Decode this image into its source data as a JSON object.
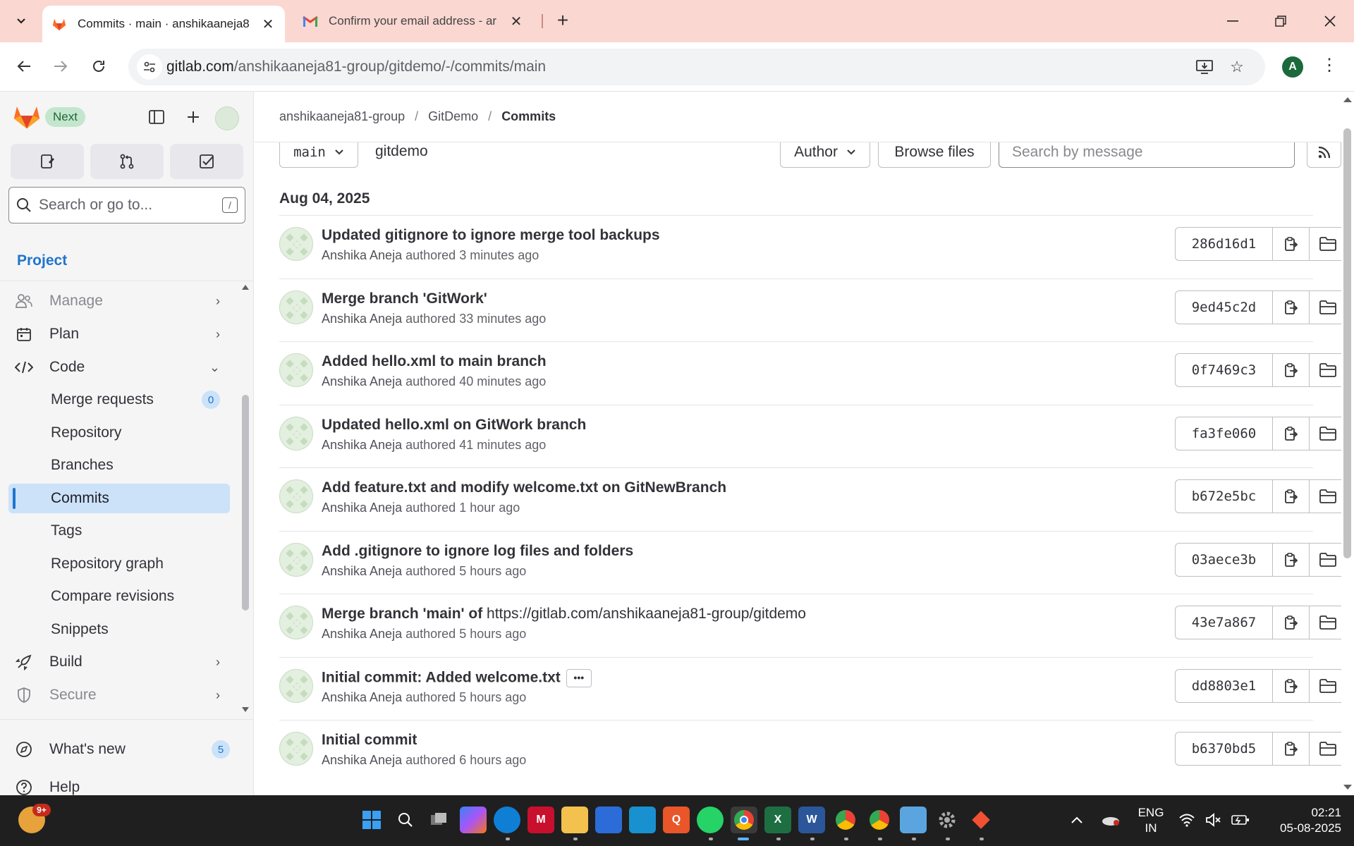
{
  "browser": {
    "tabs": [
      {
        "title": "Commits · main · anshikaaneja8",
        "active": true
      },
      {
        "title": "Confirm your email address - ar",
        "active": false
      }
    ],
    "url_host": "gitlab.com",
    "url_path": "/anshikaaneja81-group/gitdemo/-/commits/main",
    "profile_initial": "A"
  },
  "sidebar": {
    "next_label": "Next",
    "search_placeholder": "Search or go to...",
    "search_shortcut": "/",
    "section_title": "Project",
    "items": [
      {
        "label": "Manage",
        "icon": "users-icon",
        "chevron": "›"
      },
      {
        "label": "Plan",
        "icon": "calendar-icon",
        "chevron": "›"
      },
      {
        "label": "Code",
        "icon": "code-icon",
        "chevron": "⌄"
      },
      {
        "label": "Merge requests",
        "badge": "0"
      },
      {
        "label": "Repository"
      },
      {
        "label": "Branches"
      },
      {
        "label": "Commits"
      },
      {
        "label": "Tags"
      },
      {
        "label": "Repository graph"
      },
      {
        "label": "Compare revisions"
      },
      {
        "label": "Snippets"
      },
      {
        "label": "Build",
        "icon": "rocket-icon",
        "chevron": "›"
      },
      {
        "label": "Secure",
        "icon": "shield-icon",
        "chevron": "›"
      }
    ],
    "whats_new": {
      "label": "What's new",
      "badge": "5"
    },
    "help": {
      "label": "Help"
    }
  },
  "breadcrumb": [
    "anshikaaneja81-group",
    "GitDemo",
    "Commits"
  ],
  "filters": {
    "branch": "main",
    "path": "gitdemo",
    "author_label": "Author",
    "browse_label": "Browse files",
    "search_placeholder": "Search by message"
  },
  "date_heading": "Aug 04, 2025",
  "commits": [
    {
      "title": "Updated gitignore to ignore merge tool backups",
      "author": "Anshika Aneja",
      "verb": "authored",
      "time": "3 minutes ago",
      "sha": "286d16d1"
    },
    {
      "title": "Merge branch 'GitWork'",
      "author": "Anshika Aneja",
      "verb": "authored",
      "time": "33 minutes ago",
      "sha": "9ed45c2d"
    },
    {
      "title": "Added hello.xml to main branch",
      "author": "Anshika Aneja",
      "verb": "authored",
      "time": "40 minutes ago",
      "sha": "0f7469c3"
    },
    {
      "title": "Updated hello.xml on GitWork branch",
      "author": "Anshika Aneja",
      "verb": "authored",
      "time": "41 minutes ago",
      "sha": "fa3fe060"
    },
    {
      "title": "Add feature.txt and modify welcome.txt on GitNewBranch",
      "author": "Anshika Aneja",
      "verb": "authored",
      "time": "1 hour ago",
      "sha": "b672e5bc"
    },
    {
      "title": "Add .gitignore to ignore log files and folders",
      "author": "Anshika Aneja",
      "verb": "authored",
      "time": "5 hours ago",
      "sha": "03aece3b"
    },
    {
      "title": "Merge branch 'main' of ",
      "link": "https://gitlab.com/anshikaaneja81-group/gitdemo",
      "author": "Anshika Aneja",
      "verb": "authored",
      "time": "5 hours ago",
      "sha": "43e7a867"
    },
    {
      "title": "Initial commit: Added welcome.txt",
      "ellipsis": "•••",
      "author": "Anshika Aneja",
      "verb": "authored",
      "time": "5 hours ago",
      "sha": "dd8803e1"
    },
    {
      "title": "Initial commit",
      "author": "Anshika Aneja",
      "verb": "authored",
      "time": "6 hours ago",
      "sha": "b6370bd5"
    }
  ],
  "taskbar": {
    "notif_badge": "9+",
    "lang_top": "ENG",
    "lang_bottom": "IN",
    "time": "02:21",
    "date": "05-08-2025"
  }
}
